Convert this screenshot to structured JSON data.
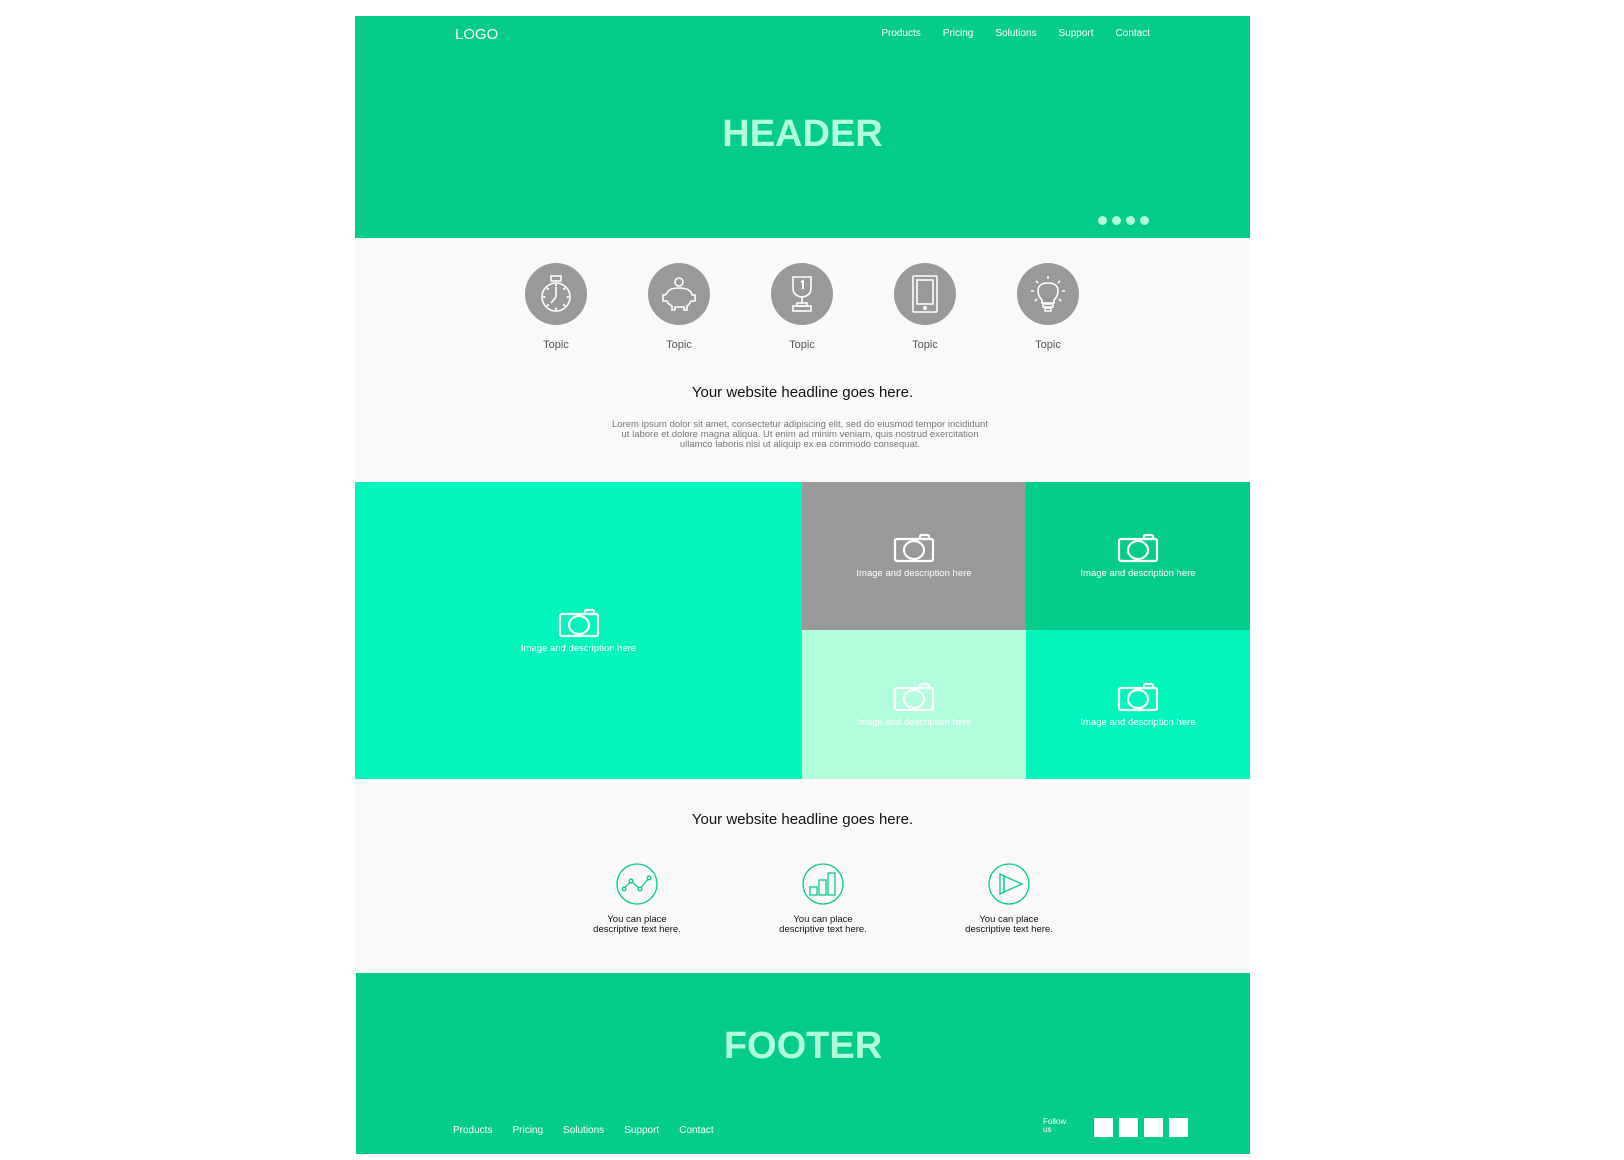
{
  "header": {
    "logo": "LOGO",
    "nav": [
      "Products",
      "Pricing",
      "Solutions",
      "Support",
      "Contact"
    ],
    "title": "HEADER",
    "carousel_dots": 4
  },
  "topics": [
    {
      "icon": "stopwatch-icon",
      "label": "Topic"
    },
    {
      "icon": "piggy-bank-icon",
      "label": "Topic"
    },
    {
      "icon": "trophy-icon",
      "label": "Topic"
    },
    {
      "icon": "tablet-icon",
      "label": "Topic"
    },
    {
      "icon": "lightbulb-icon",
      "label": "Topic"
    }
  ],
  "intro": {
    "headline": "Your website headline goes here.",
    "body": "Lorem ipsum dolor sit amet, consectetur adipiscing elit, sed do eiusmod tempor incididunt ut labore et dolore magna aliqua. Ut enim ad minim veniam, quis nostrud exercitation ullamco laboris nisi ut aliquip ex ea commodo consequat."
  },
  "gallery": [
    {
      "icon": "camera-icon",
      "text": "Image and description here"
    },
    {
      "icon": "camera-icon",
      "text": "Image and description here"
    },
    {
      "icon": "camera-icon",
      "text": "Image and description here"
    },
    {
      "icon": "camera-icon",
      "text": "Image and description here"
    },
    {
      "icon": "camera-icon",
      "text": "Image and description here"
    }
  ],
  "features_section": {
    "headline": "Your website headline goes here.",
    "items": [
      {
        "icon": "line-chart-icon",
        "text": "You can place descriptive text here."
      },
      {
        "icon": "bar-chart-icon",
        "text": "You can place descriptive text here."
      },
      {
        "icon": "play-icon",
        "text": "You can place descriptive text here."
      }
    ]
  },
  "footer": {
    "title": "FOOTER",
    "nav": [
      "Products",
      "Pricing",
      "Solutions",
      "Support",
      "Contact"
    ],
    "follow_label": "Follow us",
    "social_count": 4
  },
  "colors": {
    "primary": "#06cc8b",
    "accent": "#02f6bc",
    "pale": "#b1fedd",
    "gray": "#999999",
    "background": "#f9f9f9"
  }
}
